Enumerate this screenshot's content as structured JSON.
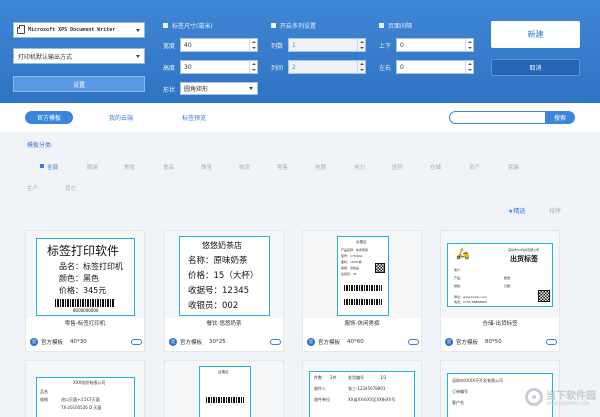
{
  "toolbar": {
    "printer": "Microsoft XPS Document Writer",
    "output_mode": "打印机默认输出方式",
    "settings_label": "设置",
    "label_size_title": "标签尺寸(毫米)",
    "multi_row_title": "开启多列设置",
    "margin_title": "页面间隔",
    "width_label": "宽度",
    "width_value": "40",
    "height_label": "高度",
    "height_value": "30",
    "shape_label": "形状",
    "shape_value": "圆角矩形",
    "cols_label": "列数",
    "cols_value": "1",
    "rows_label": "列间",
    "rows_value": "2",
    "top_bottom_label": "上下",
    "top_bottom_value": "0",
    "left_right_label": "左右",
    "left_right_value": "0",
    "new_label": "新建",
    "cancel_label": "取消"
  },
  "tabs": [
    {
      "label": "官方模板",
      "active": true
    },
    {
      "label": "我的云端",
      "active": false
    },
    {
      "label": "标签预览",
      "active": false
    }
  ],
  "search": {
    "placeholder": "",
    "button": "搜索"
  },
  "category_title": "模板分类:",
  "categories_row1": [
    "全部",
    "服装",
    "美妆",
    "食品",
    "珠宝",
    "物流",
    "零售",
    "电器",
    "电力",
    "医药",
    "仓储",
    "资产",
    "家装"
  ],
  "categories_row2": [
    "生产",
    "其它"
  ],
  "sort": {
    "featured": "★精选",
    "ranking": "排序"
  },
  "cards": [
    {
      "name": "零售-标签打印机",
      "source": "官方模板",
      "size": "40*30",
      "content": {
        "title": "标签打印软件",
        "l1": "品名：标签打印机",
        "l2": "颜色：黑色",
        "l3": "价格：345元",
        "code": "8000000000"
      }
    },
    {
      "name": "餐饮-悠悠奶茶",
      "source": "官方模板",
      "size": "30*25",
      "content": {
        "title": "悠悠奶茶店",
        "l1": "名称：原味奶茶",
        "l2": "价格：15（大杯）",
        "l3": "收据号：12345",
        "l4": "收银员：002"
      }
    },
    {
      "name": "服饰-休闲男裤",
      "source": "官方模板",
      "size": "40*60",
      "content": {
        "title": "合格证",
        "l1": "产品名称：休闲男裤",
        "l2": "型号：175/80A",
        "l3": "面料：100%棉",
        "l4": "等级：合格品",
        "l5": "检验员：05"
      }
    },
    {
      "name": "仓储-出货标签",
      "source": "官方模板",
      "size": "80*50",
      "content": {
        "company": "深圳市XX科技有限公司",
        "title": "出货标签",
        "l1": "客户：",
        "l2": "产品：",
        "l3": "数量：",
        "l4": "规格：",
        "l5": "日期：",
        "l6": "网址：www.baidu.com",
        "l7": "电话：0755-88888888"
      }
    }
  ],
  "cards_row2": [
    {
      "c1": "XXX纺织有限公司",
      "c2": "品名",
      "c3": "规格",
      "c4": "TX-20160526 D 天菌",
      "c5": "进口灭菌+3.5CF灭菌"
    },
    {
      "c1": "合格证"
    },
    {
      "c1": "件数",
      "c2": "2件",
      "c3": "发货编号",
      "c4": "1/2",
      "c5": "收件人",
      "c6": "张三-12345678901",
      "c7": "收件单位",
      "c8": "XX省XX市XX区XX街XX号"
    },
    {
      "c1": "深圳市XXXX不开发有限公司",
      "c2": "订单编号",
      "c3": "客户名"
    }
  ],
  "watermark": {
    "title": "当下软件园",
    "url": "WWW.DOWNXIA.COM"
  }
}
